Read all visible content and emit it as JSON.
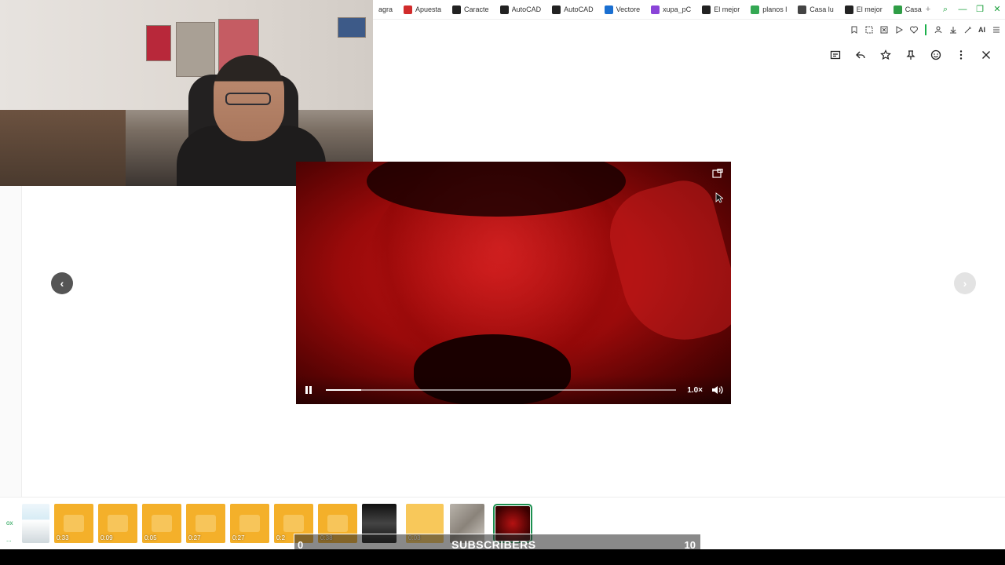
{
  "bookmarks": [
    {
      "label": "agra",
      "color": "#ffffff"
    },
    {
      "label": "Apuesta",
      "color": "#d12b2b"
    },
    {
      "label": "Caracte",
      "color": "#222222"
    },
    {
      "label": "AutoCAD",
      "color": "#222222"
    },
    {
      "label": "AutoCAD",
      "color": "#222222"
    },
    {
      "label": "Vectore",
      "color": "#1a6fd1"
    },
    {
      "label": "xupa_pC",
      "color": "#8a44d8"
    },
    {
      "label": "El mejor",
      "color": "#222222"
    },
    {
      "label": "planos l",
      "color": "#34a853"
    },
    {
      "label": "Casa lu",
      "color": "#444444"
    },
    {
      "label": "El mejor",
      "color": "#222222"
    },
    {
      "label": "Casa",
      "color": "#2f9d46"
    }
  ],
  "window": {
    "new_tab": "+",
    "search": "⌕",
    "minimize": "—",
    "restore": "❐",
    "close": "✕"
  },
  "toolbar": {
    "ai_label": "AI"
  },
  "viewer": {
    "prev": "‹",
    "next": "›"
  },
  "video": {
    "speed": "1.0×",
    "progress": 0.1
  },
  "thumbnails": [
    {
      "type": "doc",
      "duration": ""
    },
    {
      "type": "audio",
      "duration": "0:33"
    },
    {
      "type": "audio",
      "duration": "0:09"
    },
    {
      "type": "audio",
      "duration": "0:05"
    },
    {
      "type": "audio",
      "duration": "0:27"
    },
    {
      "type": "audio",
      "duration": "0:27"
    },
    {
      "type": "audio",
      "duration": "0:2"
    },
    {
      "type": "audio",
      "duration": "0:38"
    },
    {
      "type": "image",
      "duration": ""
    },
    {
      "type": "audio-faded",
      "duration": "0:03"
    },
    {
      "type": "image2",
      "duration": ""
    },
    {
      "type": "video-selected",
      "duration": ""
    }
  ],
  "strip_labels": {
    "top": "ox",
    "bottom": "..."
  },
  "subscribers": {
    "start": "0",
    "label": "SUBSCRIBERS",
    "goal": "10"
  },
  "colors": {
    "accent_green": "#1b8f4f",
    "audio_thumb": "#f4b02a",
    "video_red": "#c41414"
  }
}
